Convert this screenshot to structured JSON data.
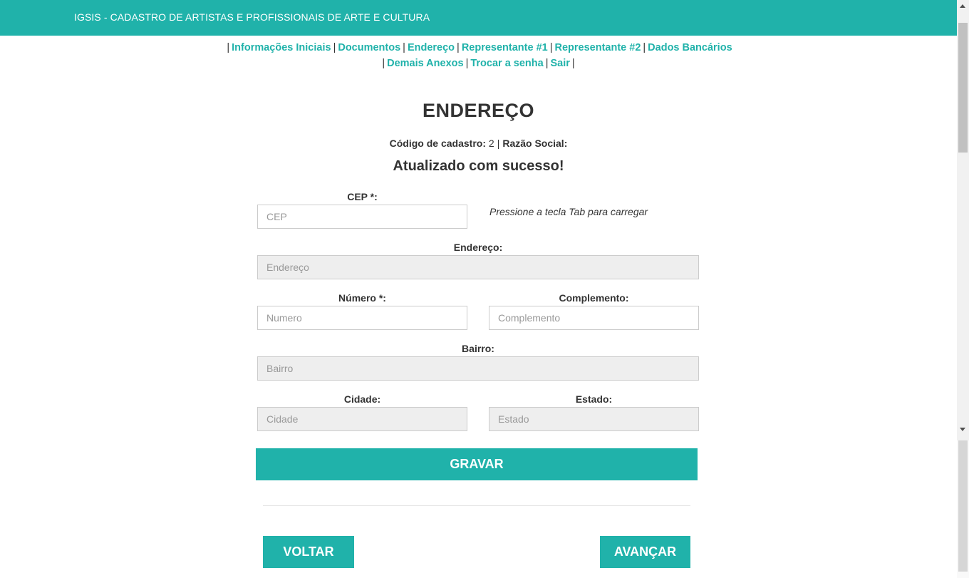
{
  "header": {
    "brand": "IGSIS - CADASTRO DE ARTISTAS E PROFISSIONAIS DE ARTE E CULTURA"
  },
  "nav": {
    "sep": "|",
    "items": [
      "Informações Iniciais",
      "Documentos",
      "Endereço",
      "Representante #1",
      "Representante #2",
      "Dados Bancários",
      "Demais Anexos",
      "Trocar a senha",
      "Sair"
    ]
  },
  "page": {
    "title": "ENDEREÇO",
    "code_label": "Código de cadastro:",
    "code_value": "2",
    "razao_label": "Razão Social:",
    "razao_value": "",
    "success": "Atualizado com sucesso!"
  },
  "form": {
    "cep": {
      "label": "CEP *:",
      "placeholder": "CEP",
      "value": ""
    },
    "cep_hint": "Pressione a tecla Tab para carregar",
    "endereco": {
      "label": "Endereço:",
      "placeholder": "Endereço",
      "value": ""
    },
    "numero": {
      "label": "Número *:",
      "placeholder": "Numero",
      "value": ""
    },
    "complemento": {
      "label": "Complemento:",
      "placeholder": "Complemento",
      "value": ""
    },
    "bairro": {
      "label": "Bairro:",
      "placeholder": "Bairro",
      "value": ""
    },
    "cidade": {
      "label": "Cidade:",
      "placeholder": "Cidade",
      "value": ""
    },
    "estado": {
      "label": "Estado:",
      "placeholder": "Estado",
      "value": ""
    },
    "submit": "GRAVAR"
  },
  "footer": {
    "back": "VOLTAR",
    "next": "AVANÇAR"
  },
  "colors": {
    "accent": "#20b2aa",
    "readonly_bg": "#eeeeee"
  }
}
